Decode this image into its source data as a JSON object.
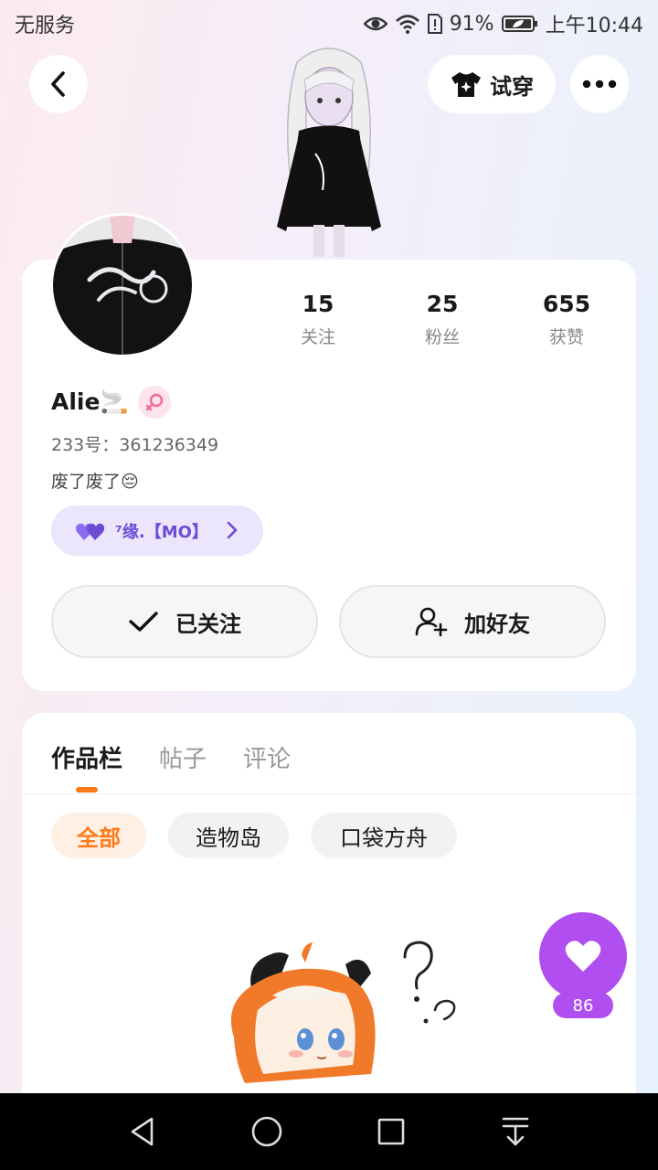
{
  "status_bar": {
    "carrier": "无服务",
    "battery_percent": "91%",
    "time": "上午10:44"
  },
  "header": {
    "try_on_label": "试穿",
    "icons": {
      "back": "chevron-left-icon",
      "try_on": "tshirt-sparkle-icon",
      "more": "more-dots-icon"
    }
  },
  "profile": {
    "name": "Alie🚬",
    "gender_icon": "female-icon",
    "uid": "233号：361236349",
    "bio": "废了废了😔",
    "relation": "⁷缘.【MO】",
    "stats": [
      {
        "value": "15",
        "label": "关注"
      },
      {
        "value": "25",
        "label": "粉丝"
      },
      {
        "value": "655",
        "label": "获赞"
      }
    ],
    "follow_button": "已关注",
    "add_friend_button": "加好友",
    "accent_color": "#6c4bd6"
  },
  "content": {
    "tabs": [
      "作品栏",
      "帖子",
      "评论"
    ],
    "active_tab": 0,
    "filters": [
      "全部",
      "造物岛",
      "口袋方舟"
    ],
    "active_filter": 0,
    "accent_color": "#ff7a1a"
  },
  "like_fab": {
    "count": "86",
    "color": "#b04ef0"
  },
  "nav_bar": {
    "icons": [
      "back-triangle-icon",
      "home-circle-icon",
      "recents-square-icon",
      "notification-pull-icon"
    ]
  }
}
